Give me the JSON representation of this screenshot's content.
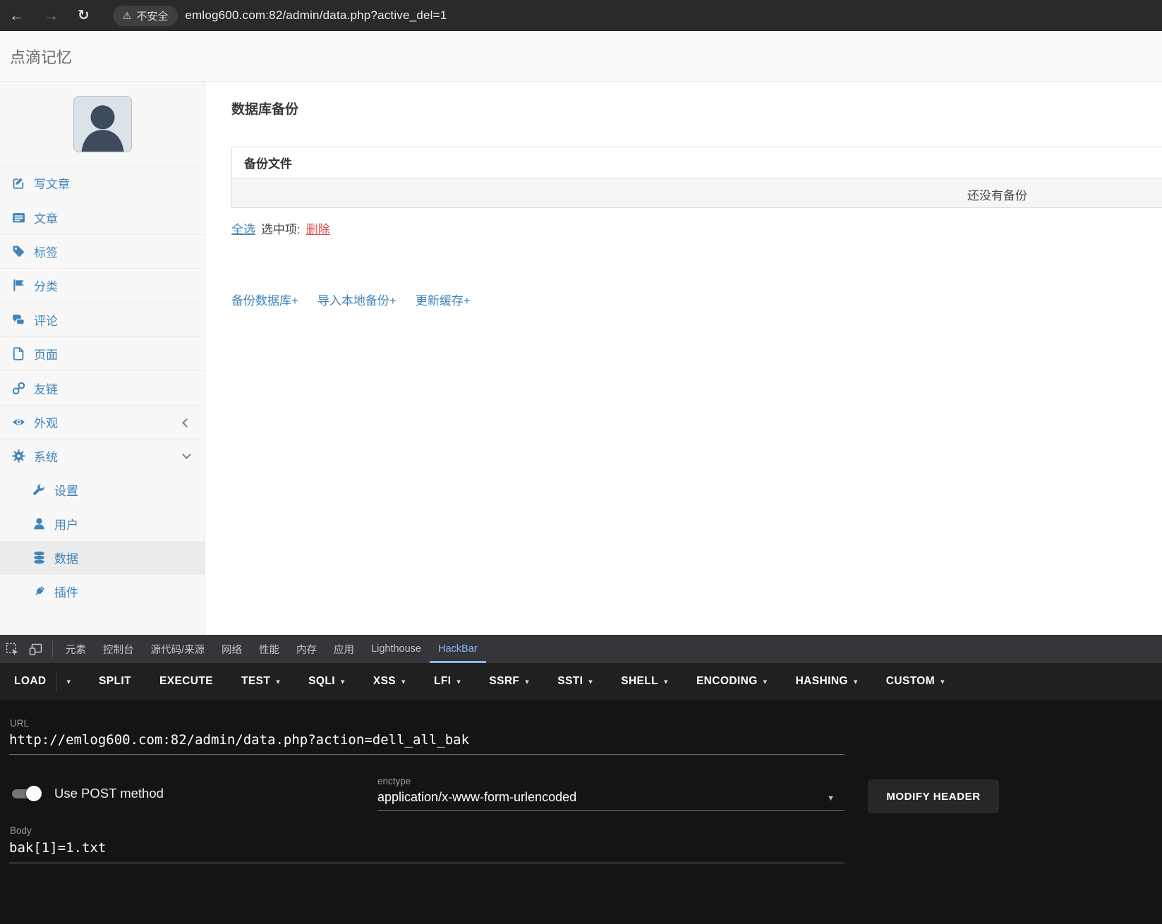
{
  "browser": {
    "security_label": "不安全",
    "url": "emlog600.com:82/admin/data.php?active_del=1"
  },
  "icons": {
    "back": "←",
    "forward": "→",
    "refresh": "↻",
    "warning": "⚠",
    "caret_down": "▾",
    "dropdown_arrow": "▼"
  },
  "site": {
    "title": "点滴记忆"
  },
  "sidebar": {
    "items": [
      {
        "label": "写文章",
        "icon": "compose-icon"
      },
      {
        "label": "文章",
        "icon": "articles-icon"
      },
      {
        "label": "标签",
        "icon": "tag-icon"
      },
      {
        "label": "分类",
        "icon": "category-flag-icon"
      },
      {
        "label": "评论",
        "icon": "comments-icon"
      },
      {
        "label": "页面",
        "icon": "page-icon"
      },
      {
        "label": "友链",
        "icon": "links-icon"
      },
      {
        "label": "外观",
        "icon": "appearance-eye-icon",
        "state": "collapsed"
      },
      {
        "label": "系统",
        "icon": "system-gear-icon",
        "state": "expanded"
      }
    ],
    "subitems": [
      {
        "label": "设置",
        "icon": "settings-wrench-icon",
        "active": false
      },
      {
        "label": "用户",
        "icon": "users-icon",
        "active": false
      },
      {
        "label": "数据",
        "icon": "database-icon",
        "active": true
      },
      {
        "label": "插件",
        "icon": "plugin-icon",
        "active": false
      }
    ]
  },
  "main": {
    "title": "数据库备份",
    "table": {
      "header": "备份文件",
      "empty_text": "还没有备份"
    },
    "toolbar": {
      "select_all": "全选",
      "selected_label": "选中项:",
      "delete": "删除"
    },
    "actions": [
      "备份数据库+",
      "导入本地备份+",
      "更新缓存+"
    ]
  },
  "devtools": {
    "tabs": [
      "元素",
      "控制台",
      "源代码/来源",
      "网络",
      "性能",
      "内存",
      "应用",
      "Lighthouse",
      "HackBar"
    ],
    "active_tab": "HackBar",
    "hackbar": {
      "menu": [
        {
          "label": "LOAD",
          "caret": "split"
        },
        {
          "label": "SPLIT",
          "caret": "none"
        },
        {
          "label": "EXECUTE",
          "caret": "none"
        },
        {
          "label": "TEST",
          "caret": "down"
        },
        {
          "label": "SQLI",
          "caret": "down"
        },
        {
          "label": "XSS",
          "caret": "down"
        },
        {
          "label": "LFI",
          "caret": "down"
        },
        {
          "label": "SSRF",
          "caret": "down"
        },
        {
          "label": "SSTI",
          "caret": "down"
        },
        {
          "label": "SHELL",
          "caret": "down"
        },
        {
          "label": "ENCODING",
          "caret": "down"
        },
        {
          "label": "HASHING",
          "caret": "down"
        },
        {
          "label": "CUSTOM",
          "caret": "down"
        }
      ],
      "url_label": "URL",
      "url_value": "http://emlog600.com:82/admin/data.php?action=dell_all_bak",
      "post_toggle": {
        "label": "Use POST method",
        "enabled": true
      },
      "enctype": {
        "label": "enctype",
        "value": "application/x-www-form-urlencoded"
      },
      "modify_header_button": "MODIFY HEADER",
      "body_label": "Body",
      "body_value": "bak[1]=1.txt"
    }
  },
  "colors": {
    "sidebar_link": "#4184b9",
    "delete_link": "#d9534f",
    "devtools_active_tab": "#8ab4f8",
    "hackbar_panel_bg": "#141414",
    "browser_bar_bg": "#2a2a2a"
  }
}
